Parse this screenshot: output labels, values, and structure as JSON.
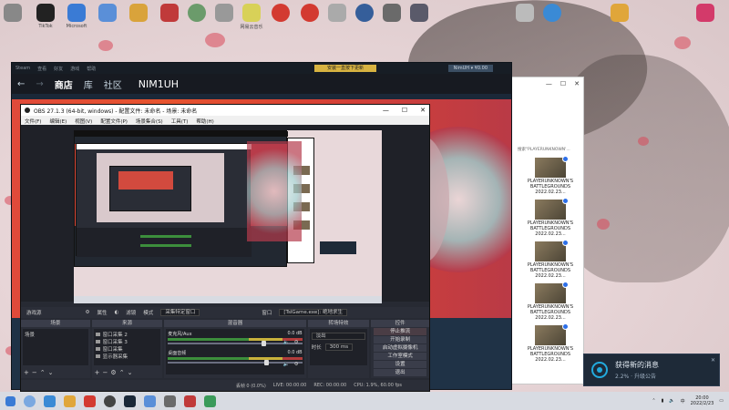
{
  "desktop": {
    "icons": [
      {
        "label": ""
      },
      {
        "label": "TikTok"
      },
      {
        "label": "Microsoft"
      },
      {
        "label": ""
      },
      {
        "label": ""
      },
      {
        "label": ""
      },
      {
        "label": ""
      },
      {
        "label": ""
      },
      {
        "label": "网易云音乐"
      },
      {
        "label": ""
      },
      {
        "label": ""
      },
      {
        "label": ""
      },
      {
        "label": ""
      },
      {
        "label": ""
      },
      {
        "label": ""
      },
      {
        "label": ""
      },
      {
        "label": ""
      },
      {
        "label": ""
      },
      {
        "label": ""
      }
    ]
  },
  "steam": {
    "nav": {
      "store": "商店",
      "library": "库",
      "community": "社区",
      "username": "NIM1UH"
    },
    "install_label": "安装一直按下更新",
    "account_label": "NimUH ▾ ¥0.00"
  },
  "explorer": {
    "search_text": "搜索\"PLAYERUNKNOWN'...",
    "items": [
      {
        "name": "PLAYERUNKNOWN'S BATTLEGROUNDS 2022.02.23..."
      },
      {
        "name": "PLAYERUNKNOWN'S BATTLEGROUNDS 2022.02.23..."
      },
      {
        "name": "PLAYERUNKNOWN'S BATTLEGROUNDS 2022.02.23..."
      },
      {
        "name": "PLAYERUNKNOWN'S BATTLEGROUNDS 2022.02.23..."
      },
      {
        "name": "PLAYERUNKNOWN'S BATTLEGROUNDS 2022.02.23..."
      }
    ]
  },
  "obs": {
    "title": "OBS 27.1.3 (64-bit, windows) - 配置文件: 未命名 - 场景: 未命名",
    "menu": [
      "文件(F)",
      "编辑(E)",
      "视图(V)",
      "配置文件(P)",
      "场景集合(S)",
      "工具(T)",
      "帮助(H)"
    ],
    "source_bar": {
      "source": "游戏源",
      "properties": "属性",
      "filters": "滤镜",
      "mode_label": "模式",
      "mode_value": "采集特定窗口",
      "window_label": "窗口",
      "window_value": "[TslGame.exe]: 绝地求生"
    },
    "docks": {
      "scenes": {
        "header": "场景",
        "items": [
          "场景"
        ]
      },
      "sources": {
        "header": "来源",
        "items": [
          "窗口采集 2",
          "窗口采集 3",
          "窗口采集",
          "显示器采集"
        ]
      },
      "mixer": {
        "header": "混音器",
        "channels": [
          {
            "name": "麦克风/Aux",
            "db": "0.0 dB",
            "level": 0.7
          },
          {
            "name": "桌面音频",
            "db": "0.0 dB",
            "level": 0.72
          }
        ]
      },
      "transitions": {
        "header": "转场特效",
        "type": "淡出",
        "duration_label": "时长",
        "duration_value": "300 ms"
      },
      "controls": {
        "header": "控件",
        "buttons": [
          "停止推流",
          "开始录制",
          "启动虚拟摄像机",
          "工作室模式",
          "设置",
          "退出"
        ]
      }
    },
    "status": [
      "丢帧 0 (0.0%)",
      "LIVE: 00:00:00",
      "REC: 00:00:00",
      "CPU: 1.9%, 60.00 fps"
    ]
  },
  "notification": {
    "title": "获得新的消息",
    "body": "2.2% · 升级公告",
    "close": "✕"
  },
  "taskbar": {
    "clock_time": "20:00",
    "clock_date": "2022/2/23",
    "tray_lang": "中"
  }
}
